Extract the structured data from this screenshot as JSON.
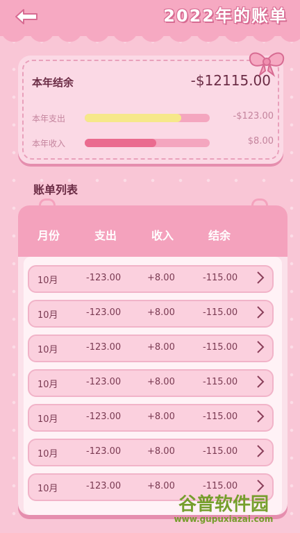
{
  "header": {
    "title": "2022年的账单"
  },
  "summary": {
    "balance_label": "本年结余",
    "balance_value": "-$12115.00",
    "expense_label": "本年支出",
    "expense_value": "-$123.00",
    "expense_ratio": 0.77,
    "income_label": "本年收入",
    "income_value": "$8.00",
    "income_ratio": 0.57
  },
  "section": {
    "title": "账单列表"
  },
  "table": {
    "columns": [
      "月份",
      "支出",
      "收入",
      "结余"
    ],
    "rows": [
      {
        "month": "10月",
        "expense": "-123.00",
        "income": "+8.00",
        "balance": "-115.00"
      },
      {
        "month": "10月",
        "expense": "-123.00",
        "income": "+8.00",
        "balance": "-115.00"
      },
      {
        "month": "10月",
        "expense": "-123.00",
        "income": "+8.00",
        "balance": "-115.00"
      },
      {
        "month": "10月",
        "expense": "-123.00",
        "income": "+8.00",
        "balance": "-115.00"
      },
      {
        "month": "10月",
        "expense": "-123.00",
        "income": "+8.00",
        "balance": "-115.00"
      },
      {
        "month": "10月",
        "expense": "-123.00",
        "income": "+8.00",
        "balance": "-115.00"
      },
      {
        "month": "10月",
        "expense": "-123.00",
        "income": "+8.00",
        "balance": "-115.00"
      }
    ]
  },
  "watermark": {
    "name": "谷普软件园",
    "url": "www.gupuxiazai.com"
  },
  "colors": {
    "bg": "#f9c6d6",
    "accent": "#f4a2bd",
    "expense_bar": "#f6e88a",
    "income_bar": "#ea6b8f"
  }
}
